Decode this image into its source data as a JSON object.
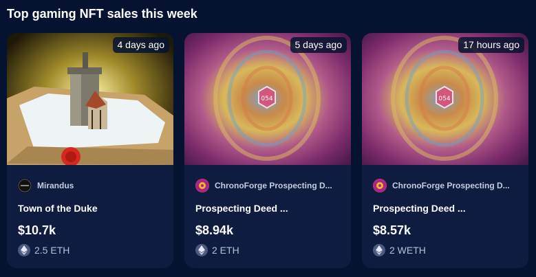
{
  "section": {
    "title": "Top gaming NFT sales this week"
  },
  "cards": [
    {
      "time_ago": "4 days ago",
      "collection": "Mirandus",
      "collection_icon": "mirandus-logo-icon",
      "name": "Town of the Duke",
      "price_usd": "$10.7k",
      "price_crypto": "2.5 ETH",
      "crypto_icon": "ethereum-icon"
    },
    {
      "time_ago": "5 days ago",
      "collection": "ChronoForge Prospecting D...",
      "collection_icon": "chronoforge-logo-icon",
      "name": "Prospecting Deed ...",
      "price_usd": "$8.94k",
      "price_crypto": "2 ETH",
      "crypto_icon": "ethereum-icon"
    },
    {
      "time_ago": "17 hours ago",
      "collection": "ChronoForge Prospecting D...",
      "collection_icon": "chronoforge-logo-icon",
      "name": "Prospecting Deed ...",
      "price_usd": "$8.57k",
      "price_crypto": "2 WETH",
      "crypto_icon": "ethereum-icon"
    }
  ],
  "colors": {
    "background": "#061330",
    "card": "#0e1d3f",
    "text_primary": "#ffffff",
    "text_secondary": "#c6cde0"
  }
}
